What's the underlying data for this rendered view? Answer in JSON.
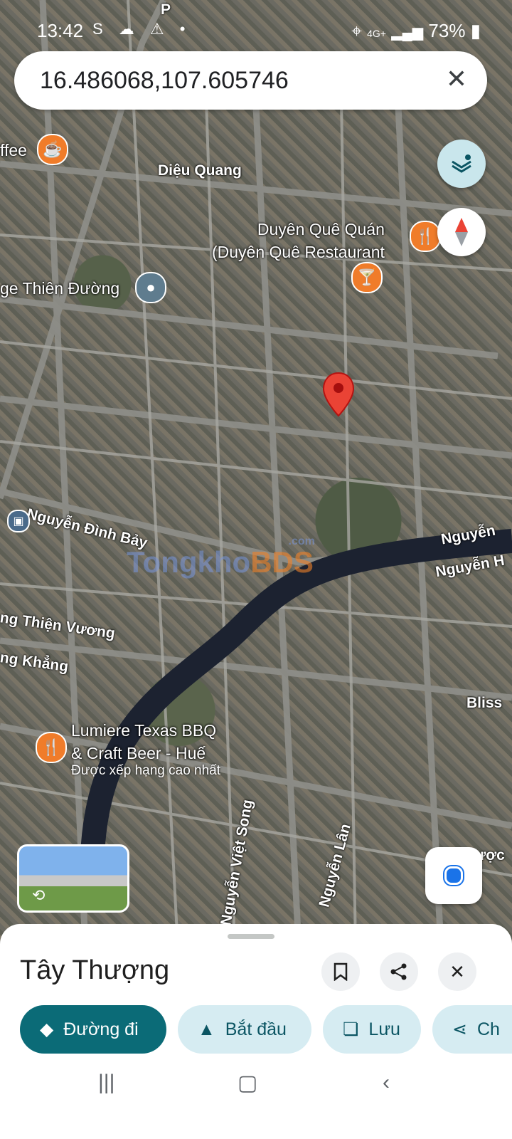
{
  "status_bar": {
    "time": "13:42",
    "left_icons": "S ☁ ⚠ •",
    "network": "4G+",
    "battery": "73%"
  },
  "search": {
    "value": "16.486068,107.605746"
  },
  "map": {
    "pois": [
      {
        "label": "ffee",
        "icon": "coffee-icon"
      },
      {
        "label": "Duyên Quê Quán\n(Duyên Quê Restaurant",
        "icon": "restaurant-icon"
      },
      {
        "label": "ge Thiên Đường",
        "icon": "place-icon"
      },
      {
        "label": "Lumiere Texas BBQ\n& Craft Beer - Huế",
        "sub": "Được xếp hạng cao nhất",
        "icon": "restaurant-icon"
      }
    ],
    "roads": {
      "dieu_quang": "Diệu Quang",
      "nguyen_dinh_bay": "Nguyễn Đình Bảy",
      "nguyen_right_1": "Nguyễn",
      "nguyen_right_2": "Nguyễn H",
      "thien_vuong": "ng Thiện Vương",
      "khang": "ng Khẳng",
      "bliss": "Bliss",
      "nguyen_viet_song": "Nguyễn Việt Song",
      "nguyen_lan": "Nguyễn Lân",
      "p_top": "P",
      "duoc": "ược"
    },
    "watermark": {
      "a": "Tongkho",
      "b": "BDS",
      "c": ".com"
    }
  },
  "sheet": {
    "title": "Tây Thượng",
    "actions": [
      {
        "label": "Đường đi",
        "icon": "directions-icon"
      },
      {
        "label": "Bắt đầu",
        "icon": "navigation-arrow-icon"
      },
      {
        "label": "Lưu",
        "icon": "bookmark-icon"
      },
      {
        "label": "Ch",
        "icon": "share-icon"
      }
    ]
  },
  "colors": {
    "accent": "#0b6b77",
    "pin": "#ea4335",
    "poi": "#f07c2a"
  }
}
